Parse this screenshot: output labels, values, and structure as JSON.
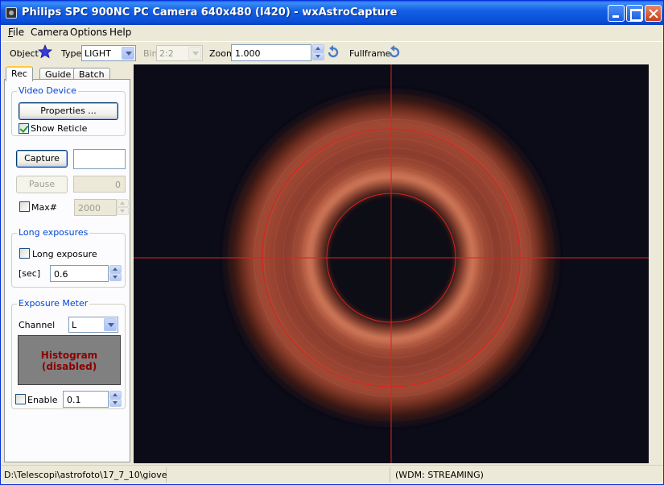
{
  "window": {
    "title": "Philips SPC 900NC PC Camera 640x480 (I420) - wxAstroCapture"
  },
  "menu": [
    {
      "label": "File",
      "u": "F",
      "rest": "ile"
    },
    {
      "label": "Camera",
      "u": "",
      "rest": "Camera"
    },
    {
      "label": "Options",
      "u": "",
      "rest": "Options"
    },
    {
      "label": "Help",
      "u": "",
      "rest": "Help"
    }
  ],
  "toolbar": {
    "object_label": "Object",
    "type_label": "Type",
    "type_value": "LIGHT",
    "bin_label": "Bin",
    "bin_value": "2:2",
    "zoom_label": "Zoom",
    "zoom_value": "1.000",
    "fullframe_label": "Fullframe"
  },
  "tabs": {
    "rec": "Rec",
    "guide": "Guide",
    "batch": "Batch"
  },
  "video_device": {
    "title": "Video Device",
    "properties_label": "Properties ...",
    "show_reticle_label": "Show Reticle",
    "show_reticle_checked": true
  },
  "capture": {
    "capture_label": "Capture",
    "capture_value": "",
    "pause_label": "Pause",
    "pause_value": "0",
    "max_label": "Max#",
    "max_value": "2000",
    "max_checked": false
  },
  "long_exposures": {
    "title": "Long exposures",
    "checkbox_label": "Long exposure",
    "checked": false,
    "sec_label": "[sec]",
    "sec_value": "0.6"
  },
  "exposure_meter": {
    "title": "Exposure Meter",
    "channel_label": "Channel",
    "channel_value": "L",
    "histogram_line1": "Histogram",
    "histogram_line2": "(disabled)",
    "enable_label": "Enable",
    "enable_checked": false,
    "enable_value": "0.1"
  },
  "status": {
    "path": "D:\\Telescopi\\astrofoto\\17_7_10\\giove",
    "middle": "",
    "mode": "(WDM: STREAMING)"
  },
  "colors": {
    "reticle": "#e0201c",
    "ring": "#c8684a",
    "background": "#0c0c18"
  }
}
